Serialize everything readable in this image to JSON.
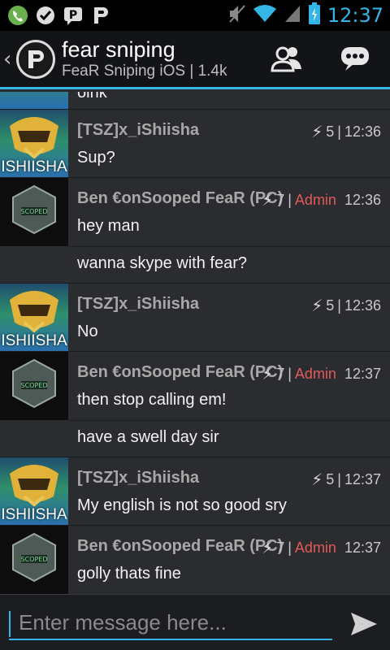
{
  "status_bar": {
    "time": "12:37",
    "icons": [
      "phone-icon",
      "check-icon",
      "chat-bubble-p-icon",
      "p-icon",
      "mute-icon",
      "wifi-icon",
      "signal-icon",
      "battery-icon"
    ]
  },
  "header": {
    "title": "fear sniping",
    "subtitle": "FeaR Sniping iOS | 1.4k"
  },
  "partial_top_text": "oink",
  "messages": [
    {
      "user": "[TSZ]x_iShiisha",
      "avatar_label": "ISHIISHA",
      "level": "5",
      "role": "",
      "time": "12:36",
      "lines": [
        "Sup?"
      ]
    },
    {
      "user": "Ben  €onSooped FeaR (PC)",
      "level": "7",
      "role": "Admin",
      "time": "12:36",
      "lines": [
        "hey man",
        "wanna skype with fear?"
      ]
    },
    {
      "user": "[TSZ]x_iShiisha",
      "avatar_label": "ISHIISHA",
      "level": "5",
      "role": "",
      "time": "12:36",
      "lines": [
        "No"
      ]
    },
    {
      "user": "Ben  €onSooped FeaR (PC)",
      "level": "7",
      "role": "Admin",
      "time": "12:37",
      "lines": [
        "then stop calling em!",
        "have a swell day sir"
      ]
    },
    {
      "user": "[TSZ]x_iShiisha",
      "avatar_label": "ISHIISHA",
      "level": "5",
      "role": "",
      "time": "12:37",
      "lines": [
        "My english is not so good sry"
      ]
    },
    {
      "user": "Ben  €onSooped FeaR (PC)",
      "level": "7",
      "role": "Admin",
      "time": "12:37",
      "lines": [
        "golly thats fine"
      ]
    }
  ],
  "input": {
    "placeholder": "Enter message here..."
  },
  "colors": {
    "accent": "#33b5e5",
    "admin": "#e05a5a"
  }
}
